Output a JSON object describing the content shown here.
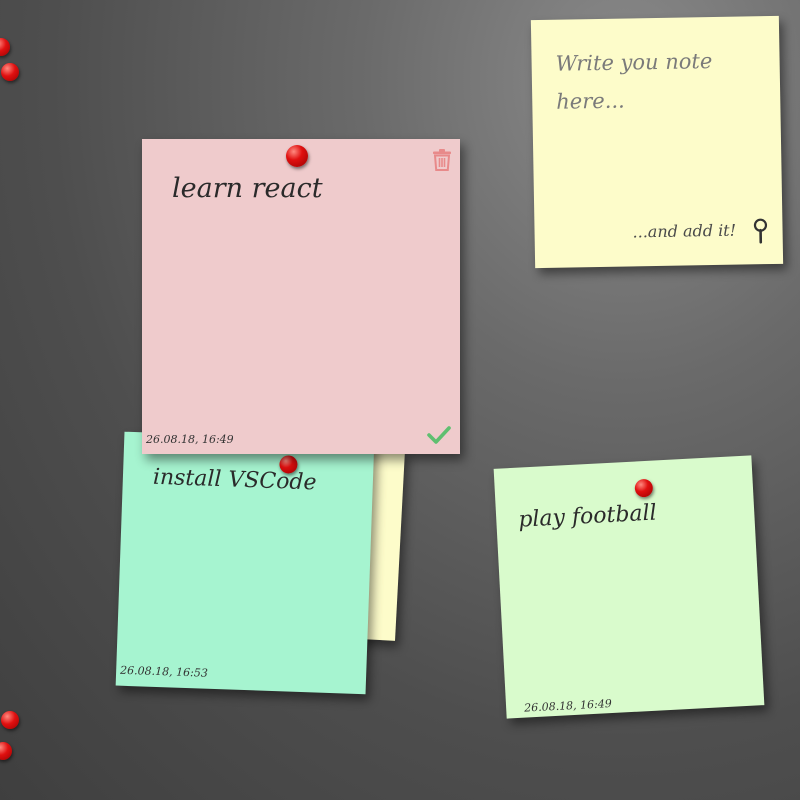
{
  "new_note": {
    "placeholder_line1": "Write you note",
    "placeholder_line2": "here...",
    "add_label": "...and add it!",
    "add_icon": "pin-icon",
    "color": "#fdfcca"
  },
  "notes": [
    {
      "text": "learn react",
      "date": "26.08.18, 16:49",
      "color": "#efcbcc",
      "delete_icon": "trash-icon",
      "done_icon": "check-icon"
    },
    {
      "text": "install VSCode",
      "date": "26.08.18, 16:53",
      "color": "#a6f4d0"
    },
    {
      "text": "play football",
      "date": "26.08.18, 16:49",
      "color": "#d9fbcc"
    }
  ],
  "colors": {
    "pin": "#e01010",
    "trash_icon": "#e88a8a",
    "check_icon": "#5fbf70",
    "background": "#555555"
  }
}
